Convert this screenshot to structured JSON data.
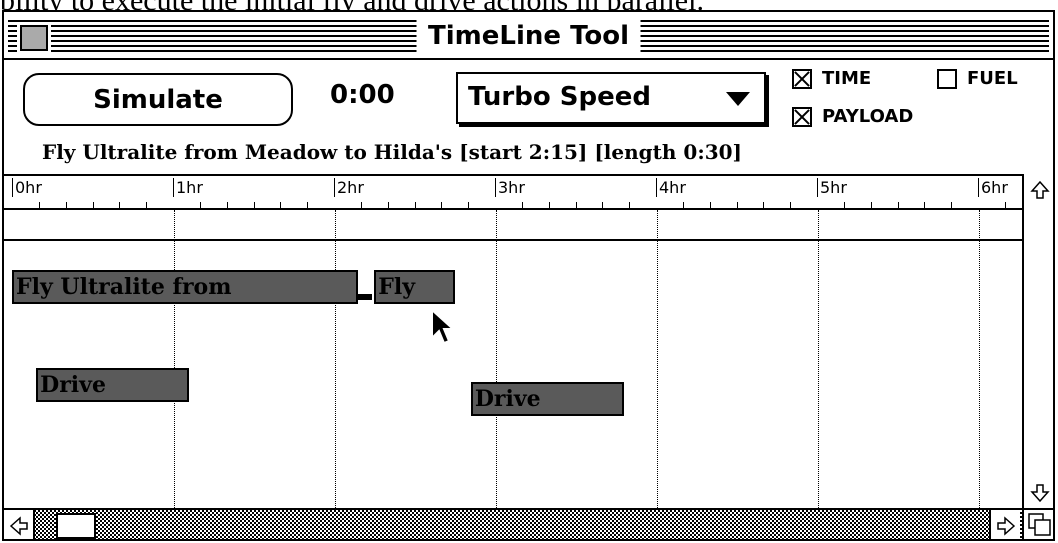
{
  "caption": "bility to execute the initial fly and drive actions in parallel.",
  "window": {
    "title": "TimeLine Tool"
  },
  "toolbar": {
    "simulate_label": "Simulate",
    "clock": "0:00",
    "speed_value": "Turbo Speed",
    "time_label": "TIME",
    "time_checked": true,
    "fuel_label": "FUEL",
    "fuel_checked": false,
    "payload_label": "PAYLOAD",
    "payload_checked": true
  },
  "selection_info": "Fly Ultralite from Meadow to Hilda's  [start 2:15] [length 0:30]",
  "ruler": {
    "labels": [
      "0hr",
      "1hr",
      "2hr",
      "3hr",
      "4hr",
      "5hr",
      "6hr"
    ]
  },
  "tasks": [
    {
      "label": "Fly Ultralite from",
      "start_hr": 0.0,
      "end_hr": 2.15
    },
    {
      "label": "Fly",
      "start_hr": 2.25,
      "end_hr": 2.75
    },
    {
      "label": "Drive",
      "start_hr": 0.15,
      "end_hr": 1.1
    },
    {
      "label": "Drive",
      "start_hr": 2.85,
      "end_hr": 3.8
    }
  ],
  "icons": [
    "close-box-icon",
    "up-arrow-icon",
    "down-arrow-icon",
    "left-arrow-icon",
    "right-arrow-icon",
    "grow-box-icon",
    "pointer-cursor-icon"
  ]
}
